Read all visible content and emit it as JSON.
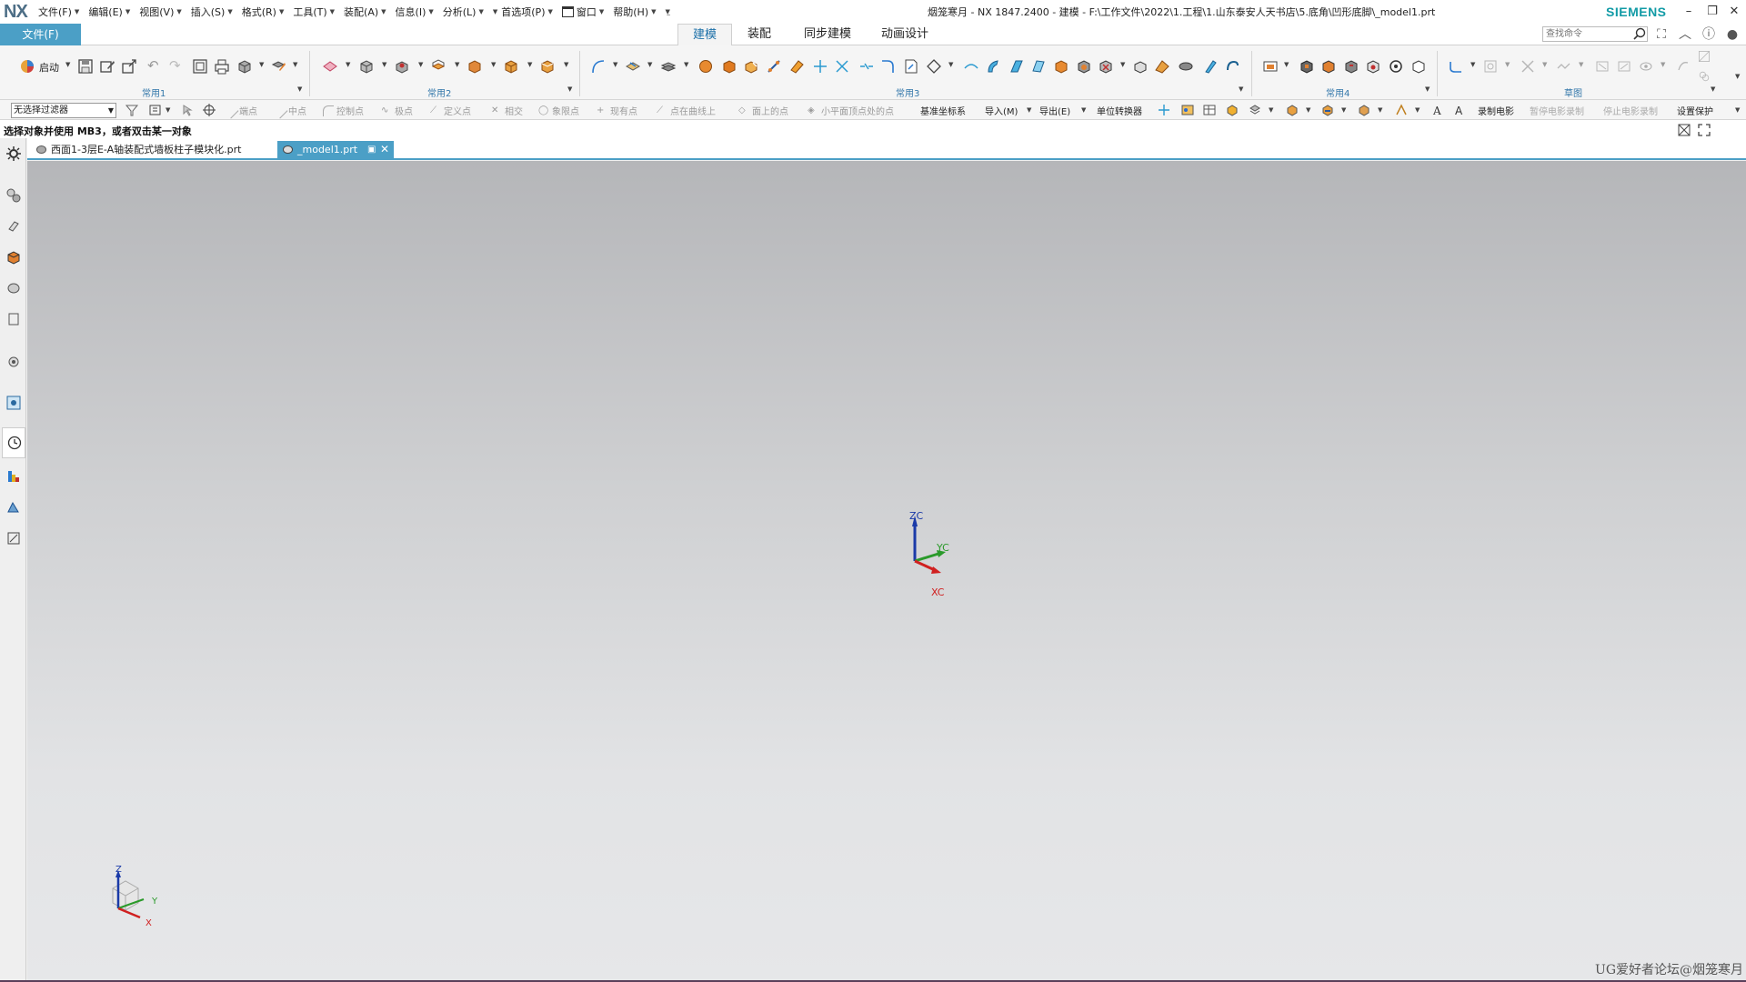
{
  "titlebar": {
    "logo": "NX",
    "menus": [
      {
        "label": "文件(F)"
      },
      {
        "label": "编辑(E)"
      },
      {
        "label": "视图(V)"
      },
      {
        "label": "插入(S)"
      },
      {
        "label": "格式(R)"
      },
      {
        "label": "工具(T)"
      },
      {
        "label": "装配(A)"
      },
      {
        "label": "信息(I)"
      },
      {
        "label": "分析(L)"
      },
      {
        "label": "首选项(P)"
      },
      {
        "label": "窗口"
      },
      {
        "label": "帮助(H)"
      }
    ],
    "window_title": "烟笼寒月 - NX 1847.2400 - 建模 - F:\\工作文件\\2022\\1.工程\\1.山东泰安人天书店\\5.底角\\凹形底脚\\_model1.prt",
    "brand": "SIEMENS"
  },
  "ribbon_tabs": {
    "file_tab": "文件(F)",
    "tabs": [
      {
        "label": "建模",
        "active": true
      },
      {
        "label": "装配"
      },
      {
        "label": "同步建模"
      },
      {
        "label": "动画设计"
      }
    ],
    "search_placeholder": "查找命令"
  },
  "ribbon": {
    "start_label": "启动",
    "groups": [
      {
        "label": "常用1"
      },
      {
        "label": "常用2"
      },
      {
        "label": "常用3"
      },
      {
        "label": "常用4"
      },
      {
        "label": "草图"
      }
    ]
  },
  "selection_bar": {
    "filter_value": "无选择过滤器",
    "snaps": [
      {
        "label": "端点"
      },
      {
        "label": "中点"
      },
      {
        "label": "控制点"
      },
      {
        "label": "极点"
      },
      {
        "label": "定义点"
      },
      {
        "label": "相交"
      },
      {
        "label": "象限点"
      },
      {
        "label": "现有点"
      },
      {
        "label": "点在曲线上"
      },
      {
        "label": "面上的点"
      },
      {
        "label": "小平面顶点处的点"
      }
    ],
    "commands": [
      {
        "label": "基准坐标系"
      },
      {
        "label": "导入(M)"
      },
      {
        "label": "导出(E)"
      },
      {
        "label": "单位转换器"
      }
    ],
    "record_labels": [
      {
        "label": "录制电影",
        "enabled": true
      },
      {
        "label": "暂停电影录制",
        "enabled": false
      },
      {
        "label": "停止电影录制",
        "enabled": false
      },
      {
        "label": "设置保护",
        "enabled": true
      }
    ]
  },
  "cue_line": "选择对象并使用 MB3，或者双击某一对象",
  "document_tabs": [
    {
      "label": "西面1-3层E-A轴装配式墙板柱子模块化.prt",
      "active": false
    },
    {
      "label": "_model1.prt",
      "active": true
    }
  ],
  "viewport": {
    "wcs_labels": {
      "z": "ZC",
      "y": "YC",
      "x": "XC"
    },
    "triad_labels": {
      "z": "Z",
      "y": "Y",
      "x": "X"
    },
    "watermark": "UG爱好者论坛@烟笼寒月"
  },
  "colors": {
    "accent": "#4b9fc6",
    "brand": "#129ba6",
    "axis_x": "#d02020",
    "axis_y": "#2a9a2a",
    "axis_z": "#1a3aa8"
  }
}
